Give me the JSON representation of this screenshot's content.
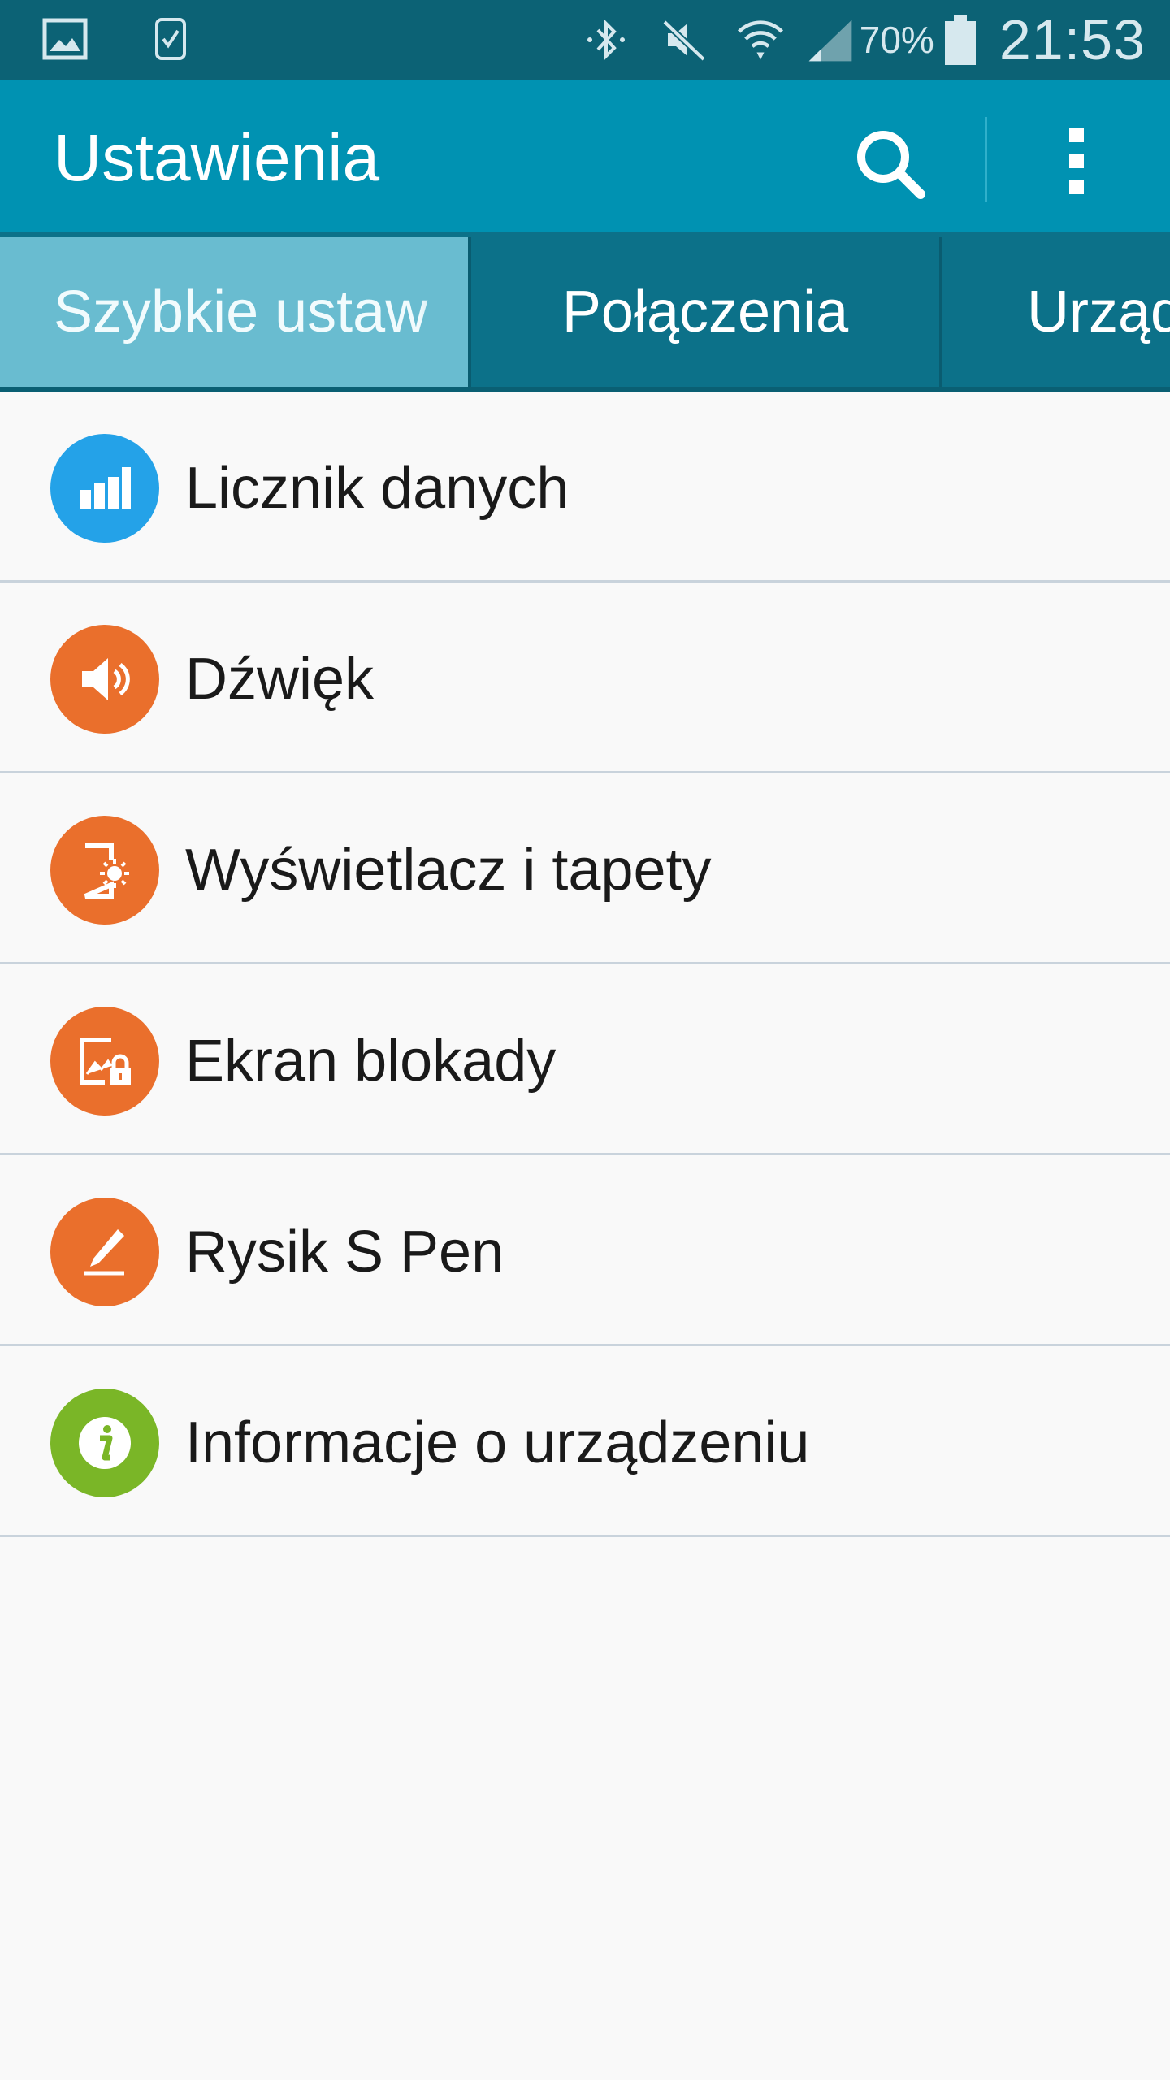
{
  "status_bar": {
    "battery_percent": "70%",
    "time": "21:53",
    "icons": [
      "gallery-icon",
      "watch-icon",
      "bluetooth-icon",
      "mute-icon",
      "wifi-icon",
      "signal-icon",
      "battery-icon"
    ]
  },
  "app_bar": {
    "title": "Ustawienia",
    "icons": [
      "search-icon",
      "more-vert-icon"
    ]
  },
  "tabs": [
    {
      "label": "Szybkie ustaw",
      "selected": true
    },
    {
      "label": "Połączenia",
      "selected": false
    },
    {
      "label": "Urząd",
      "selected": false
    }
  ],
  "colors": {
    "status_bar": "#0c6275",
    "app_bar": "#0092b2",
    "tab_bar": "#0c7189",
    "tab_selected": "#69bcd0",
    "icon_blue": "#24a2e8",
    "icon_orange": "#ea6f2c",
    "icon_green": "#7ab627"
  },
  "settings": [
    {
      "label": "Licznik danych",
      "icon": "data-usage-icon",
      "icon_color": "#24a2e8"
    },
    {
      "label": "Dźwięk",
      "icon": "speaker-icon",
      "icon_color": "#ea6f2c"
    },
    {
      "label": "Wyświetlacz i tapety",
      "icon": "display-brightness-icon",
      "icon_color": "#ea6f2c"
    },
    {
      "label": "Ekran blokady",
      "icon": "lock-screen-icon",
      "icon_color": "#ea6f2c"
    },
    {
      "label": "Rysik S Pen",
      "icon": "s-pen-icon",
      "icon_color": "#ea6f2c"
    },
    {
      "label": "Informacje o urządzeniu",
      "icon": "info-icon",
      "icon_color": "#7ab627"
    }
  ]
}
